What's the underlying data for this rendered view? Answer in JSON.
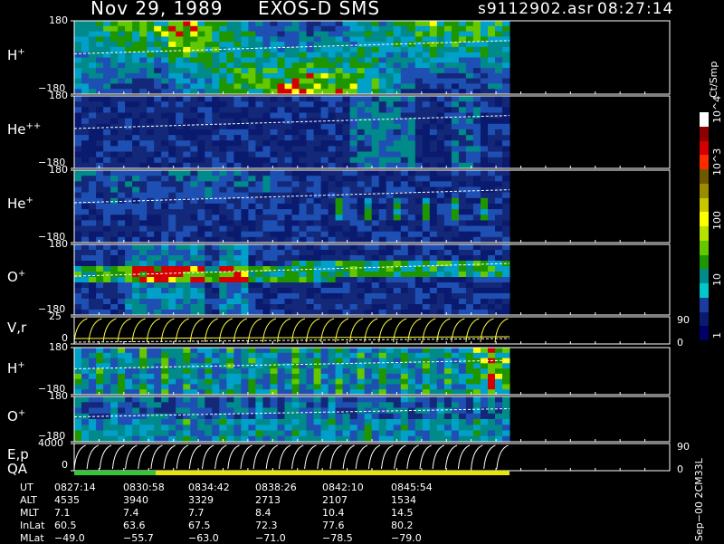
{
  "header": {
    "date": "Nov 29, 1989",
    "instrument": "EXOS-D SMS",
    "file": "s9112902.asr",
    "time": "08:27:14"
  },
  "panels": [
    {
      "label": "H",
      "sup": "+",
      "top": "180",
      "bottom": "−180"
    },
    {
      "label": "He",
      "sup": "++",
      "top": "180",
      "bottom": "−180"
    },
    {
      "label": "He",
      "sup": "+",
      "top": "180",
      "bottom": "−180"
    },
    {
      "label": "O",
      "sup": "+",
      "top": "180",
      "bottom": "−180"
    },
    {
      "label": "V,r",
      "sup": "",
      "top": "25",
      "bottom": "0",
      "right_top": "90",
      "right_bottom": "0"
    },
    {
      "label": "H",
      "sup": "+",
      "top": "180",
      "bottom": "−180"
    },
    {
      "label": "O",
      "sup": "+",
      "top": "180",
      "bottom": "−180"
    },
    {
      "label": "E,p",
      "sup": "",
      "top": "4000",
      "bottom": "0",
      "right_top": "90",
      "right_bottom": "0"
    }
  ],
  "qa_label": "QA",
  "colorbar": {
    "title": "Ct/Smp",
    "ticks": [
      "10^4",
      "10^3",
      "100",
      "10",
      "1"
    ],
    "colors": [
      "#ffffff",
      "#8b0000",
      "#d40000",
      "#ff2a00",
      "#6b5a00",
      "#9c8a00",
      "#c8c800",
      "#ffff00",
      "#b8e000",
      "#64c800",
      "#1e9600",
      "#008a8a",
      "#00c8c8",
      "#1a3ca0",
      "#0a1a6e",
      "#000066"
    ]
  },
  "footer": {
    "rows": [
      {
        "name": "UT",
        "values": [
          "0827:14",
          "0830:58",
          "0834:42",
          "0838:26",
          "0842:10",
          "0845:54"
        ]
      },
      {
        "name": "ALT",
        "values": [
          "4535",
          "3940",
          "3329",
          "2713",
          "2107",
          "1534"
        ]
      },
      {
        "name": "MLT",
        "values": [
          "7.1",
          "7.4",
          "7.7",
          "8.4",
          "10.4",
          "14.5"
        ]
      },
      {
        "name": "InLat",
        "values": [
          "60.5",
          "63.6",
          "67.5",
          "72.3",
          "77.6",
          "80.2"
        ]
      },
      {
        "name": "MLat",
        "values": [
          "−49.0",
          "−55.7",
          "−63.0",
          "−71.0",
          "−78.5",
          "−79.0"
        ]
      }
    ]
  },
  "version_label": "Sep−00  2CM33L",
  "chart_data": {
    "type": "heatmap",
    "title": "Nov 29, 1989   EXOS-D SMS",
    "x": [
      "0827:14",
      "0830:58",
      "0834:42",
      "0838:26",
      "0842:10",
      "0845:54"
    ],
    "panels": [
      "H+",
      "He++",
      "He+",
      "O+",
      "V,r",
      "H+",
      "O+",
      "E,p"
    ],
    "ylim_pitch": [
      -180,
      180
    ],
    "ylim_vr": [
      0,
      25
    ],
    "ylim_ep": [
      0,
      4000
    ],
    "ylim_right": [
      0,
      90
    ],
    "colorscale_log": [
      1,
      10000
    ],
    "colorbar_title": "Ct/Smp"
  }
}
